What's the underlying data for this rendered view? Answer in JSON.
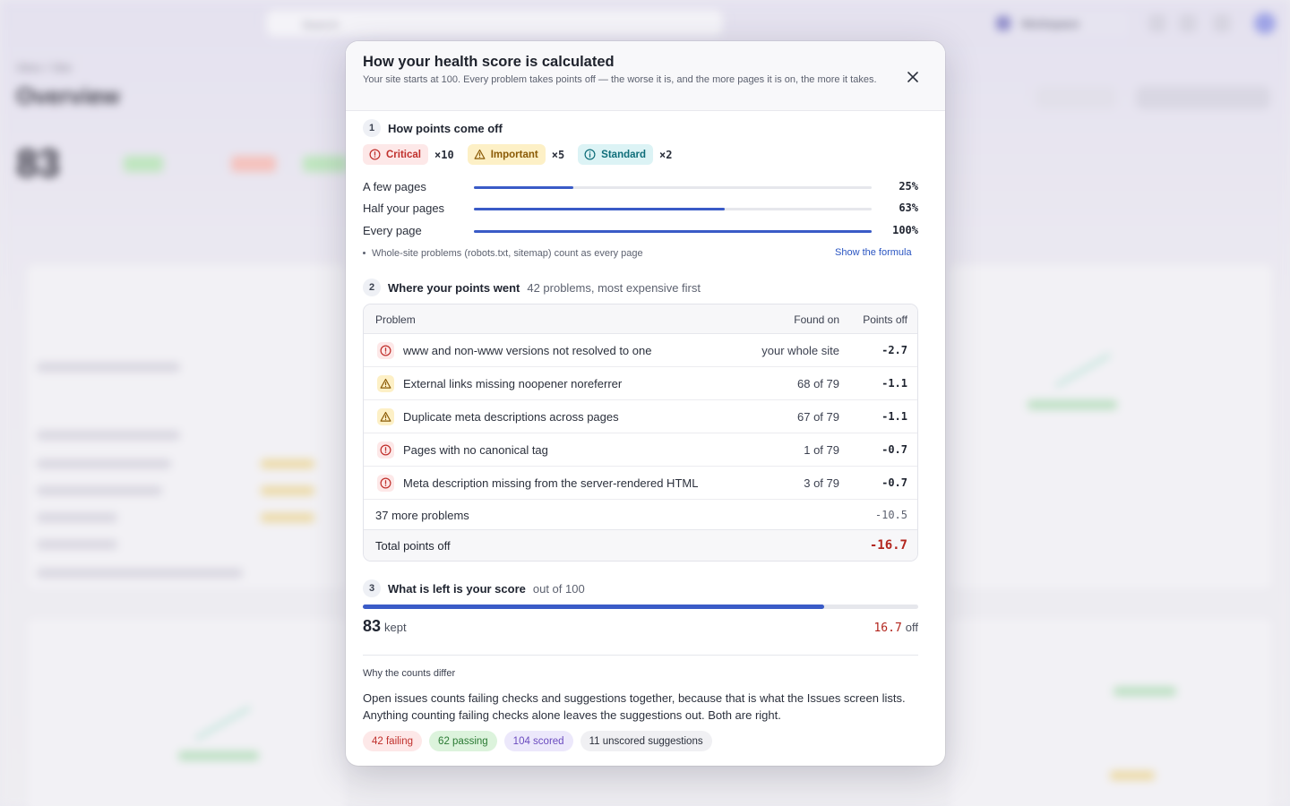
{
  "background": {
    "search_placeholder": "Search",
    "workspace": "Workspace",
    "breadcrumb": "Sites / Site",
    "page_title": "Overview",
    "score": "83"
  },
  "modal": {
    "title": "How your health score is calculated",
    "subtitle": "Your site starts at 100. Every problem takes points off — the worse it is, and the more pages it is on, the more it takes.",
    "close_icon": "close-icon",
    "step1": {
      "number": "1",
      "label": "How points come off",
      "severities": [
        {
          "label": "Critical",
          "multiplier": "×10",
          "color": "#c0302c"
        },
        {
          "label": "Important",
          "multiplier": "×5",
          "color": "#8a5a05"
        },
        {
          "label": "Standard",
          "multiplier": "×2",
          "color": "#0f6e7a"
        }
      ],
      "coverage": [
        {
          "label": "A few pages",
          "value": "25%",
          "fraction": 0.25
        },
        {
          "label": "Half your pages",
          "value": "63%",
          "fraction": 0.63
        },
        {
          "label": "Every page",
          "value": "100%",
          "fraction": 1.0
        }
      ],
      "note": "Whole-site problems (robots.txt, sitemap) count as every page",
      "formula_link": "Show the formula"
    },
    "step2": {
      "number": "2",
      "label": "Where your points went",
      "extra": "42 problems, most expensive first",
      "columns": [
        "Problem",
        "Found on",
        "Points off"
      ],
      "rows": [
        {
          "severity": "critical",
          "problem": "www and non-www versions not resolved to one",
          "found": "your whole site",
          "points": "-2.7"
        },
        {
          "severity": "important",
          "problem": "External links missing noopener noreferrer",
          "found": "68 of 79",
          "points": "-1.1"
        },
        {
          "severity": "important",
          "problem": "Duplicate meta descriptions across pages",
          "found": "67 of 79",
          "points": "-1.1"
        },
        {
          "severity": "critical",
          "problem": "Pages with no canonical tag",
          "found": "1 of 79",
          "points": "-0.7"
        },
        {
          "severity": "critical",
          "problem": "Meta description missing from the server-rendered HTML",
          "found": "3 of 79",
          "points": "-0.7"
        }
      ],
      "more_label": "37 more problems",
      "more_points": "-10.5",
      "total_label": "Total points off",
      "total_points": "-16.7"
    },
    "step3": {
      "number": "3",
      "label": "What is left is your score",
      "extra": "out of 100",
      "score": "83",
      "score_fraction": 0.83,
      "kept_label": "kept",
      "off_value": "16.7",
      "off_label": "off"
    },
    "why": {
      "heading": "Why the counts differ",
      "text": "Open issues counts failing checks and suggestions together, because that is what the Issues screen lists. Anything counting failing checks alone leaves the suggestions out. Both are right.",
      "tags": [
        {
          "label": "42 failing",
          "kind": "r"
        },
        {
          "label": "62 passing",
          "kind": "g"
        },
        {
          "label": "104 scored",
          "kind": "p"
        },
        {
          "label": "11 unscored suggestions",
          "kind": "n"
        }
      ]
    }
  }
}
